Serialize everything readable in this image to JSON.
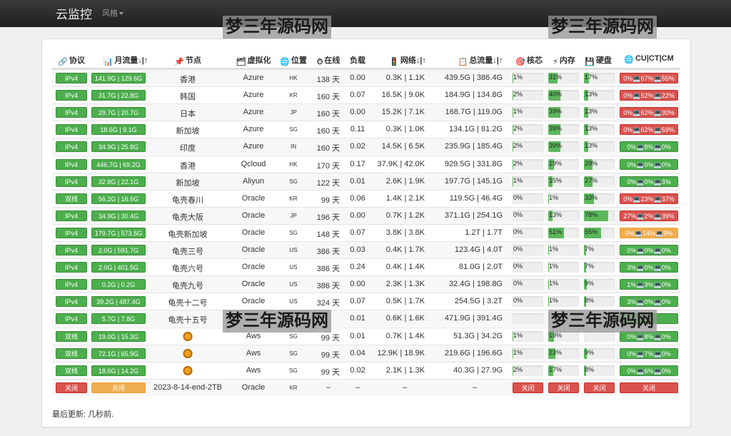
{
  "app": {
    "brand": "云监控",
    "style_menu": "风格"
  },
  "watermark": "梦三年源码网",
  "headers": {
    "protocol": "协议",
    "monthly": "月流量↓|↑",
    "node": "节点",
    "virt": "虚拟化",
    "location": "位置",
    "uptime": "在线",
    "load": "负载",
    "network": "网络↓|↑",
    "total": "总流量↓|↑",
    "cpu": "核芯",
    "mem": "内存",
    "hdd": "硬盘",
    "ping": "CU|CT|CM"
  },
  "rows": [
    {
      "protocol": "IPv4",
      "monthly": "141.9G | 129.6G",
      "name": "香港",
      "virt": "Azure",
      "loc": "HK",
      "uptime": "138 天",
      "load": "0.00",
      "net": "0.3K | 1.1K",
      "total": "439.5G | 386.4G",
      "cpu": "1%",
      "cpu_v": 1,
      "mem": "31%",
      "mem_v": 31,
      "hdd": "17%",
      "hdd_v": 17,
      "ping": "0%💻67%💻55%",
      "ping_status": "danger"
    },
    {
      "protocol": "IPv4",
      "monthly": "31.7G | 22.8G",
      "name": "韩国",
      "virt": "Azure",
      "loc": "KR",
      "uptime": "160 天",
      "load": "0.07",
      "net": "16.5K | 9.0K",
      "total": "184.9G | 134.8G",
      "cpu": "2%",
      "cpu_v": 2,
      "mem": "40%",
      "mem_v": 40,
      "hdd": "13%",
      "hdd_v": 13,
      "ping": "0%💻52%💻22%",
      "ping_status": "danger"
    },
    {
      "protocol": "IPv4",
      "monthly": "29.7G | 20.7G",
      "name": "日本",
      "virt": "Azure",
      "loc": "JP",
      "uptime": "160 天",
      "load": "0.00",
      "net": "15.2K | 7.1K",
      "total": "168.7G | 119.0G",
      "cpu": "1%",
      "cpu_v": 1,
      "mem": "39%",
      "mem_v": 39,
      "hdd": "13%",
      "hdd_v": 13,
      "ping": "0%💻62%💻30%",
      "ping_status": "danger"
    },
    {
      "protocol": "IPv4",
      "monthly": "18.6G | 9.1G",
      "name": "新加坡",
      "virt": "Azure",
      "loc": "SG",
      "uptime": "160 天",
      "load": "0.11",
      "net": "0.3K | 1.0K",
      "total": "134.1G | 81.2G",
      "cpu": "2%",
      "cpu_v": 2,
      "mem": "39%",
      "mem_v": 39,
      "hdd": "13%",
      "hdd_v": 13,
      "ping": "0%💻62%💻59%",
      "ping_status": "danger"
    },
    {
      "protocol": "IPv4",
      "monthly": "34.9G | 25.8G",
      "name": "印度",
      "virt": "Azure",
      "loc": "IN",
      "uptime": "160 天",
      "load": "0.02",
      "net": "14.5K | 6.5K",
      "total": "235.9G | 185.4G",
      "cpu": "2%",
      "cpu_v": 2,
      "mem": "39%",
      "mem_v": 39,
      "hdd": "13%",
      "hdd_v": 13,
      "ping": "0%💻8%💻0%",
      "ping_status": "ok"
    },
    {
      "protocol": "IPv4",
      "monthly": "446.7G | 69.2G",
      "name": "香港",
      "virt": "Qcloud",
      "loc": "HK",
      "uptime": "170 天",
      "load": "0.17",
      "net": "37.9K | 42.0K",
      "total": "929.5G | 331.8G",
      "cpu": "2%",
      "cpu_v": 2,
      "mem": "19%",
      "mem_v": 19,
      "hdd": "29%",
      "hdd_v": 29,
      "ping": "0%💻0%💻0%",
      "ping_status": "ok"
    },
    {
      "protocol": "IPv4",
      "monthly": "32.8G | 22.1G",
      "name": "新加坡",
      "virt": "Aliyun",
      "loc": "SG",
      "uptime": "122 天",
      "load": "0.01",
      "net": "2.6K | 1.9K",
      "total": "197.7G | 145.1G",
      "cpu": "1%",
      "cpu_v": 1,
      "mem": "15%",
      "mem_v": 15,
      "hdd": "27%",
      "hdd_v": 27,
      "ping": "0%💻0%💻3%",
      "ping_status": "ok"
    },
    {
      "protocol": "双线",
      "monthly": "56.2G | 16.6G",
      "name": "龟壳春川",
      "virt": "Oracle",
      "loc": "KR",
      "uptime": "99 天",
      "load": "0.06",
      "net": "1.4K | 2.1K",
      "total": "119.5G | 46.4G",
      "cpu": "0%",
      "cpu_v": 0,
      "mem": "1%",
      "mem_v": 1,
      "hdd": "33%",
      "hdd_v": 33,
      "ping": "0%💻23%💻37%",
      "ping_status": "danger"
    },
    {
      "protocol": "IPv4",
      "monthly": "34.9G | 30.4G",
      "name": "龟壳大阪",
      "virt": "Oracle",
      "loc": "JP",
      "uptime": "196 天",
      "load": "0.00",
      "net": "0.7K | 1.2K",
      "total": "371.1G | 254.1G",
      "cpu": "0%",
      "cpu_v": 0,
      "mem": "13%",
      "mem_v": 13,
      "hdd": "78%",
      "hdd_v": 78,
      "ping": "27%💻2%💻39%",
      "ping_status": "danger"
    },
    {
      "protocol": "IPv4",
      "monthly": "179.7G | 573.5G",
      "name": "龟壳新加坡",
      "virt": "Oracle",
      "loc": "SG",
      "uptime": "148 天",
      "load": "0.07",
      "net": "3.8K | 3.8K",
      "total": "1.2T | 1.7T",
      "cpu": "0%",
      "cpu_v": 0,
      "mem": "51%",
      "mem_v": 51,
      "hdd": "55%",
      "hdd_v": 55,
      "ping": "0%💻14%💻9%",
      "ping_status": "warning"
    },
    {
      "protocol": "IPv4",
      "monthly": "2.0G | 591.7G",
      "name": "龟壳三号",
      "virt": "Oracle",
      "loc": "US",
      "uptime": "386 天",
      "load": "0.03",
      "net": "0.4K | 1.7K",
      "total": "123.4G | 4.0T",
      "cpu": "0%",
      "cpu_v": 0,
      "mem": "1%",
      "mem_v": 1,
      "hdd": "7%",
      "hdd_v": 7,
      "ping": "0%💻0%💻0%",
      "ping_status": "ok"
    },
    {
      "protocol": "IPv4",
      "monthly": "2.0G | 401.5G",
      "name": "龟壳六号",
      "virt": "Oracle",
      "loc": "US",
      "uptime": "386 天",
      "load": "0.24",
      "net": "0.4K | 1.4K",
      "total": "81.0G | 2.0T",
      "cpu": "0%",
      "cpu_v": 0,
      "mem": "1%",
      "mem_v": 1,
      "hdd": "7%",
      "hdd_v": 7,
      "ping": "3%💻0%💻0%",
      "ping_status": "ok"
    },
    {
      "protocol": "IPv4",
      "monthly": "0.2G | 0.2G",
      "name": "龟壳九号",
      "virt": "Oracle",
      "loc": "US",
      "uptime": "386 天",
      "load": "0.00",
      "net": "2.3K | 1.3K",
      "total": "32.4G | 198.8G",
      "cpu": "0%",
      "cpu_v": 0,
      "mem": "1%",
      "mem_v": 1,
      "hdd": "9%",
      "hdd_v": 9,
      "ping": "1%💻3%💻0%",
      "ping_status": "ok"
    },
    {
      "protocol": "IPv4",
      "monthly": "39.2G | 487.4G",
      "name": "龟壳十二号",
      "virt": "Oracle",
      "loc": "US",
      "uptime": "324 天",
      "load": "0.07",
      "net": "0.5K | 1.7K",
      "total": "254.5G | 3.2T",
      "cpu": "0%",
      "cpu_v": 0,
      "mem": "1%",
      "mem_v": 1,
      "hdd": "8%",
      "hdd_v": 8,
      "ping": "3%💻0%💻0%",
      "ping_status": "ok"
    },
    {
      "protocol": "IPv4",
      "monthly": "5.7G | 7.8G",
      "name": "龟壳十五号",
      "virt": "",
      "loc": "",
      "uptime": "",
      "load": "0.01",
      "net": "0.6K | 1.6K",
      "total": "471.9G | 391.4G",
      "cpu": "",
      "cpu_v": 0,
      "mem": "",
      "mem_v": 0,
      "hdd": "",
      "hdd_v": 0,
      "ping": "",
      "ping_status": "ok"
    },
    {
      "protocol": "双线",
      "monthly": "19.0G | 15.3G",
      "name": "",
      "virt": "Aws",
      "loc": "SG",
      "uptime": "99 天",
      "load": "0.01",
      "net": "0.7K | 1.4K",
      "total": "51.3G | 34.2G",
      "cpu": "1%",
      "cpu_v": 1,
      "mem": "19%",
      "mem_v": 19,
      "hdd": "",
      "hdd_v": 0,
      "ping": "0%💻8%💻0%",
      "ping_status": "ok",
      "icon": "lion-icon"
    },
    {
      "protocol": "双线",
      "monthly": "72.1G | 65.9G",
      "name": "",
      "virt": "Aws",
      "loc": "SG",
      "uptime": "99 天",
      "load": "0.04",
      "net": "12.9K | 18.9K",
      "total": "219.6G | 196.6G",
      "cpu": "1%",
      "cpu_v": 1,
      "mem": "23%",
      "mem_v": 23,
      "hdd": "9%",
      "hdd_v": 9,
      "ping": "0%💻7%💻0%",
      "ping_status": "ok",
      "icon": "lion-icon"
    },
    {
      "protocol": "双线",
      "monthly": "18.6G | 14.2G",
      "name": "",
      "virt": "Aws",
      "loc": "SG",
      "uptime": "99 天",
      "load": "0.02",
      "net": "2.1K | 1.3K",
      "total": "40.3G | 27.9G",
      "cpu": "2%",
      "cpu_v": 2,
      "mem": "17%",
      "mem_v": 17,
      "hdd": "8%",
      "hdd_v": 8,
      "ping": "0%💻6%💻0%",
      "ping_status": "ok",
      "icon": "lion-icon"
    },
    {
      "protocol": "关闭",
      "monthly": "关闭",
      "name": "2023-8-14-end-2TB",
      "virt": "Oracle",
      "loc": "KR",
      "uptime": "–",
      "load": "–",
      "net": "–",
      "total": "–",
      "cpu": "关闭",
      "cpu_v": 0,
      "mem": "关闭",
      "mem_v": 0,
      "hdd": "关闭",
      "hdd_v": 0,
      "ping": "关闭",
      "ping_status": "danger",
      "offline": true
    }
  ],
  "footer": "最后更新: 几秒前.",
  "colors": {
    "ok": "#5cb85c",
    "warning": "#f0ad4e",
    "danger": "#d9534f",
    "navbar": "#222222"
  }
}
